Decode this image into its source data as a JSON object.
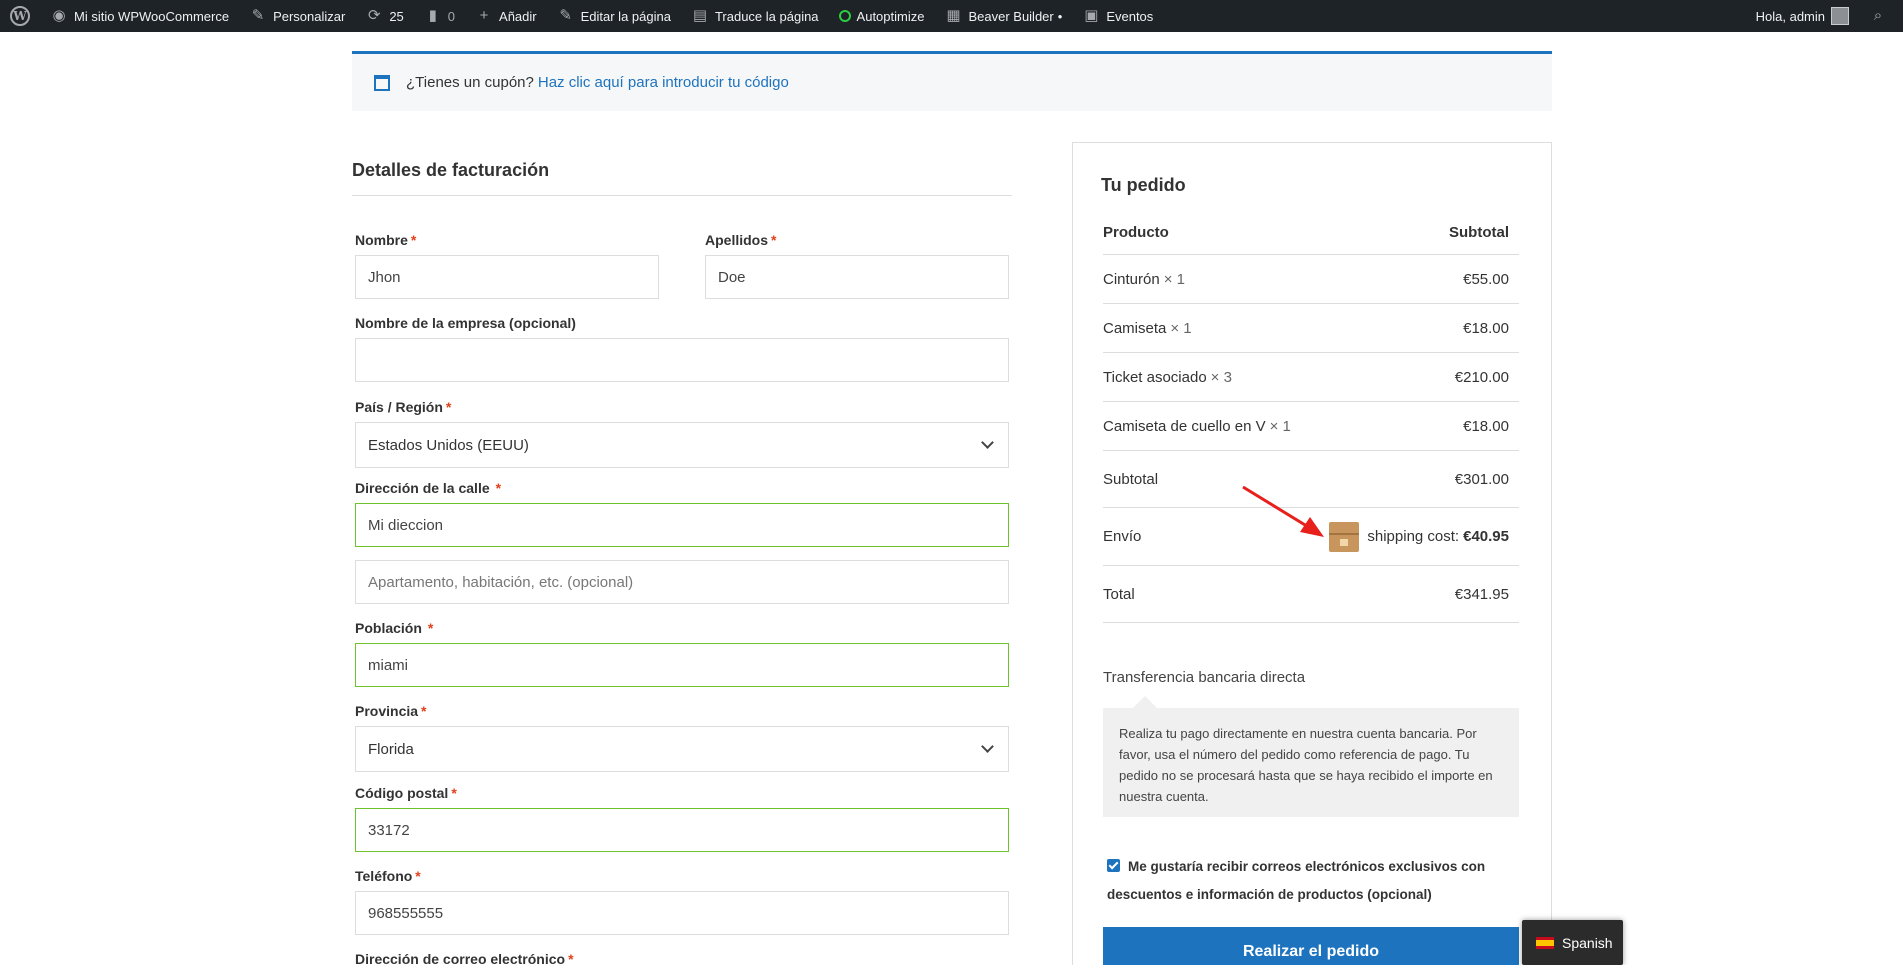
{
  "admin_bar": {
    "site": "Mi sitio WPWooCommerce",
    "customize": "Personalizar",
    "updates": "25",
    "comments": "0",
    "add_new": "Añadir",
    "edit_page": "Editar la página",
    "translate": "Traduce la página",
    "autoptimize": "Autoptimize",
    "beaver": "Beaver Builder",
    "beaver_dot": "•",
    "events": "Eventos",
    "greeting": "Hola, admin"
  },
  "coupon": {
    "question": "¿Tienes un cupón?",
    "link": "Haz clic aquí para introducir tu código"
  },
  "billing": {
    "title": "Detalles de facturación",
    "required_mark": "*",
    "first_name": {
      "label": "Nombre",
      "value": "Jhon"
    },
    "last_name": {
      "label": "Apellidos",
      "value": "Doe"
    },
    "company": {
      "label": "Nombre de la empresa (opcional)",
      "value": ""
    },
    "country": {
      "label": "País / Región",
      "value": "Estados Unidos (EEUU)"
    },
    "address": {
      "label": "Dirección de la calle",
      "value": "Mi dieccion",
      "placeholder2": "Apartamento, habitación, etc. (opcional)"
    },
    "city": {
      "label": "Población",
      "value": "miami"
    },
    "state": {
      "label": "Provincia",
      "value": "Florida"
    },
    "postcode": {
      "label": "Código postal",
      "value": "33172"
    },
    "phone": {
      "label": "Teléfono",
      "value": "968555555"
    },
    "email": {
      "label": "Dirección de correo electrónico"
    }
  },
  "order": {
    "title": "Tu pedido",
    "col_product": "Producto",
    "col_subtotal": "Subtotal",
    "items": [
      {
        "name": "Cinturón",
        "qty": "× 1",
        "price": "€55.00"
      },
      {
        "name": "Camiseta",
        "qty": "× 1",
        "price": "€18.00"
      },
      {
        "name": "Ticket asociado",
        "qty": "× 3",
        "price": "€210.00"
      },
      {
        "name": "Camiseta de cuello en V",
        "qty": "× 1",
        "price": "€18.00"
      }
    ],
    "subtotal_label": "Subtotal",
    "subtotal_value": "€301.00",
    "shipping_label": "Envío",
    "shipping_text": "shipping cost:",
    "shipping_value": "€40.95",
    "total_label": "Total",
    "total_value": "€341.95",
    "payment_title": "Transferencia bancaria directa",
    "payment_desc": "Realiza tu pago directamente en nuestra cuenta bancaria. Por favor, usa el número del pedido como referencia de pago. Tu pedido no se procesará hasta que se haya recibido el importe en nuestra cuenta.",
    "newsletter": "Me gustaría recibir correos electrónicos exclusivos con descuentos e información de productos (opcional)",
    "place_order": "Realizar el pedido"
  },
  "language": {
    "label": "Spanish"
  },
  "colors": {
    "accent": "#1e73be",
    "valid_border": "#6dc22e",
    "required": "#e2401c",
    "admin_bar": "#1d2327"
  }
}
